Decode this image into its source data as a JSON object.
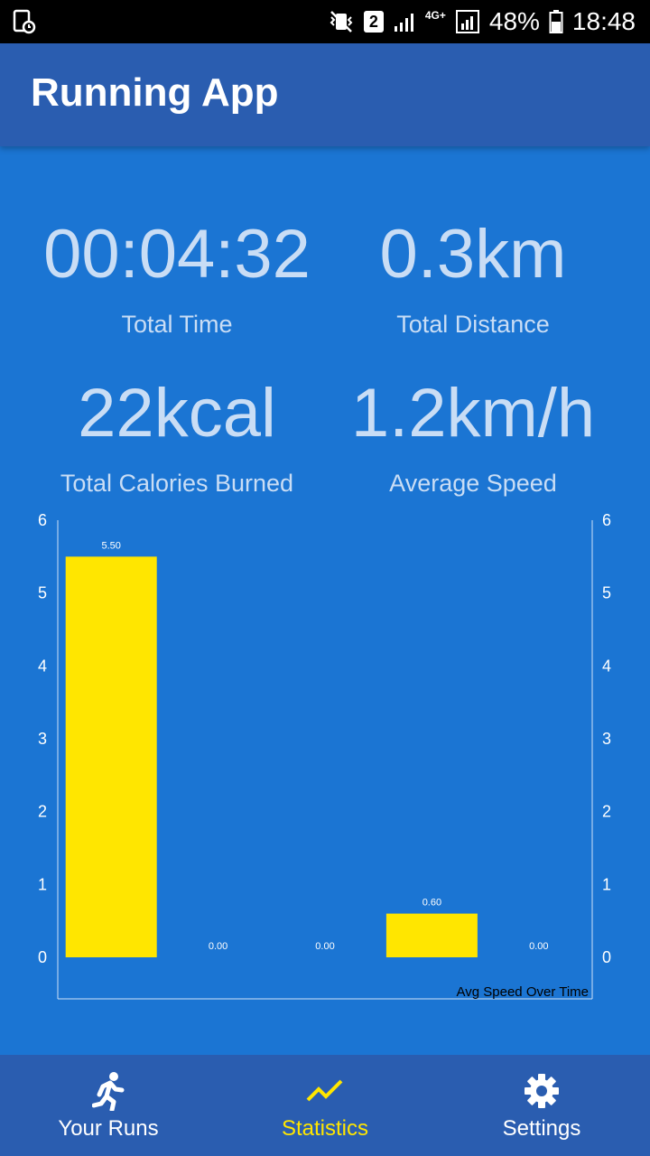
{
  "status_bar": {
    "sim": "2",
    "network": "4G+",
    "battery": "48%",
    "time": "18:48"
  },
  "app_bar": {
    "title": "Running App"
  },
  "stats": {
    "time": {
      "value": "00:04:32",
      "label": "Total Time"
    },
    "distance": {
      "value": "0.3km",
      "label": "Total Distance"
    },
    "calories": {
      "value": "22kcal",
      "label": "Total Calories Burned"
    },
    "speed": {
      "value": "1.2km/h",
      "label": "Average Speed"
    }
  },
  "colors": {
    "background": "#1b75d3",
    "bar_fill": "#ffe600",
    "nav_active": "#ffe600",
    "app_bar": "#2a5db0"
  },
  "chart_data": {
    "type": "bar",
    "description": "Avg Speed Over Time",
    "values": [
      5.5,
      0.0,
      0.0,
      0.6,
      0.0
    ],
    "value_labels": [
      "5.50",
      "0.00",
      "0.00",
      "0.60",
      "0.00"
    ],
    "ylim": [
      0,
      6
    ],
    "yticks": [
      "0",
      "1",
      "2",
      "3",
      "4",
      "5",
      "6"
    ],
    "dual_y_axis": true,
    "grid": false
  },
  "bottom_nav": {
    "items": [
      {
        "label": "Your Runs",
        "icon": "running-person-icon",
        "active": false
      },
      {
        "label": "Statistics",
        "icon": "trending-chart-icon",
        "active": true
      },
      {
        "label": "Settings",
        "icon": "gear-icon",
        "active": false
      }
    ]
  }
}
